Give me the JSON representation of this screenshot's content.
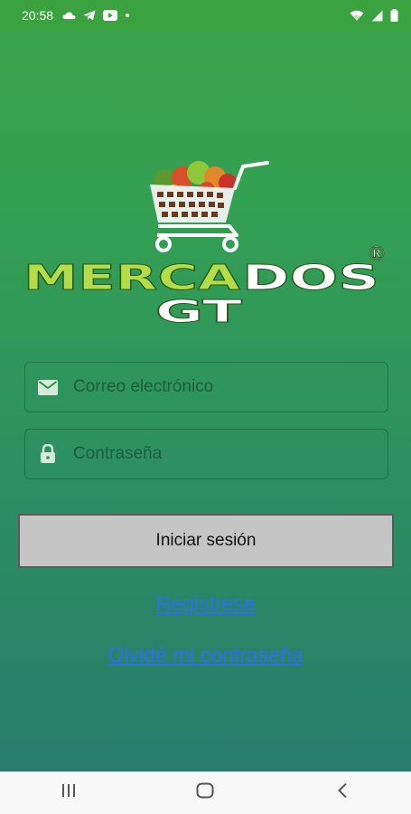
{
  "status_bar": {
    "time": "20:58",
    "left_icons": [
      "cloud-icon",
      "telegram-icon",
      "youtube-icon",
      "dot-icon"
    ],
    "right_icons": [
      "wifi-icon",
      "signal-icon",
      "battery-icon"
    ]
  },
  "logo": {
    "name_part1": "MERCA",
    "name_part2": "DOS",
    "name_line2": "GT",
    "registered_mark": "®"
  },
  "form": {
    "email": {
      "placeholder": "Correo electrónico",
      "value": "",
      "icon": "mail-icon"
    },
    "password": {
      "placeholder": "Contraseña",
      "value": "",
      "icon": "lock-icon"
    },
    "login_label": "Iniciar sesión",
    "register_label": "Registrese",
    "forgot_label": "Olvidé mi contraseña"
  },
  "nav_bar": {
    "icons": [
      "recent-apps-icon",
      "home-icon",
      "back-icon"
    ]
  },
  "colors": {
    "status_bar": "#3aa23e",
    "link": "#2d6ff0",
    "button_bg": "#c5c5c5",
    "logo_lime": "#b4dc46",
    "logo_white": "#ffffff"
  }
}
